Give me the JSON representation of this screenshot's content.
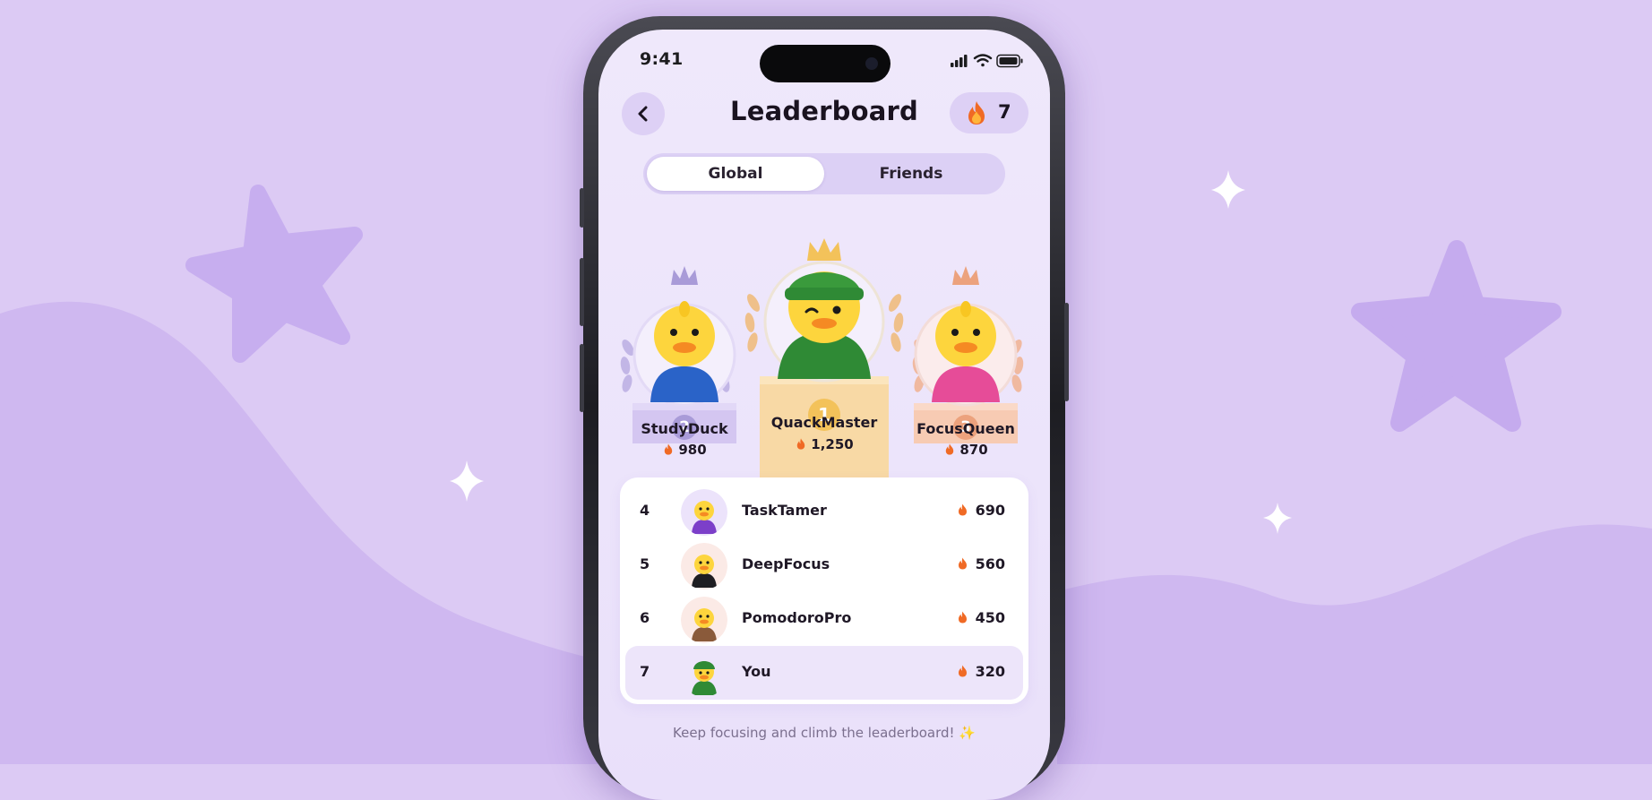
{
  "status_bar": {
    "time": "9:41"
  },
  "header": {
    "title": "Leaderboard",
    "back_icon": "chevron-left-icon",
    "streak_icon": "flame-icon",
    "streak_count": "7"
  },
  "tabs": [
    {
      "label": "Global",
      "active": true
    },
    {
      "label": "Friends",
      "active": false
    }
  ],
  "podium": {
    "first": {
      "rank": "1",
      "name": "QuackMaster",
      "score": "1,250",
      "accent": "#f3c25a"
    },
    "second": {
      "rank": "2",
      "name": "StudyDuck",
      "score": "980",
      "accent": "#a99bd8"
    },
    "third": {
      "rank": "3",
      "name": "FocusQueen",
      "score": "870",
      "accent": "#eca27d"
    }
  },
  "ranking": [
    {
      "rank": "4",
      "name": "TaskTamer",
      "score": "690",
      "hoodie": "#7c3fc9",
      "avatar_bg": "#ece3fb"
    },
    {
      "rank": "5",
      "name": "DeepFocus",
      "score": "560",
      "hoodie": "#1e1e22",
      "avatar_bg": "#fbeae6"
    },
    {
      "rank": "6",
      "name": "PomodoroPro",
      "score": "450",
      "hoodie": "#8a5a3a",
      "avatar_bg": "#fbeae6"
    },
    {
      "rank": "7",
      "name": "You",
      "score": "320",
      "hoodie": "#2f8a35",
      "avatar_bg": "#ede5fa",
      "highlight": true
    }
  ],
  "footer": {
    "message": "Keep focusing and climb the leaderboard! ✨"
  },
  "colors": {
    "background": "#dccaf4",
    "flame": "#f06a25",
    "gold": "#f3c25a"
  }
}
